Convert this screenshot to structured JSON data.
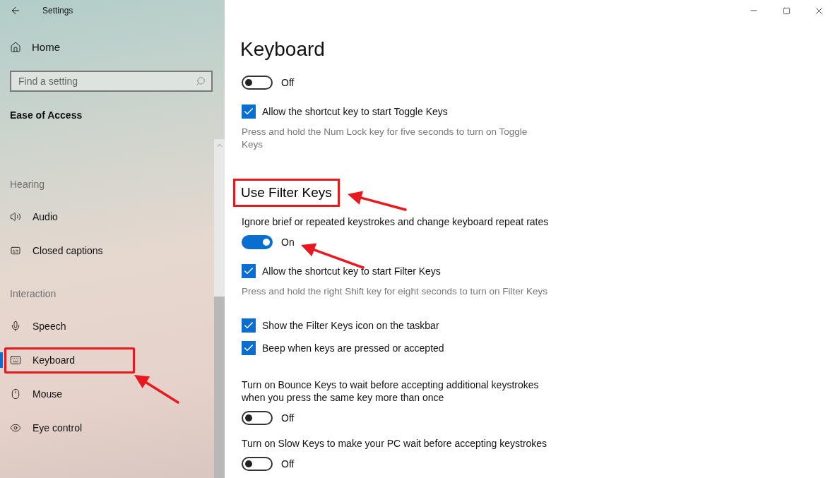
{
  "window": {
    "title": "Settings"
  },
  "sidebar": {
    "home": "Home",
    "search": {
      "placeholder": "Find a setting"
    },
    "section": "Ease of Access",
    "groups": [
      {
        "label": "Hearing",
        "items": [
          {
            "label": "Audio",
            "selected": false,
            "highlighted": false
          },
          {
            "label": "Closed captions",
            "selected": false,
            "highlighted": false
          }
        ]
      },
      {
        "label": "Interaction",
        "items": [
          {
            "label": "Speech",
            "selected": false,
            "highlighted": false
          },
          {
            "label": "Keyboard",
            "selected": true,
            "highlighted": true
          },
          {
            "label": "Mouse",
            "selected": false,
            "highlighted": false
          },
          {
            "label": "Eye control",
            "selected": false,
            "highlighted": false
          }
        ]
      }
    ]
  },
  "page": {
    "title": "Keyboard",
    "settings": [
      {
        "kind": "toggle",
        "on": false,
        "label": "Off",
        "arrow": false
      },
      {
        "kind": "checkbox",
        "checked": true,
        "label": "Allow the shortcut key to start Toggle Keys"
      },
      {
        "kind": "description",
        "text": "Press and hold the Num Lock key for five seconds to turn on Toggle Keys"
      },
      {
        "kind": "heading",
        "text": "Use Filter Keys",
        "highlighted": true
      },
      {
        "kind": "text",
        "text": "Ignore brief or repeated keystrokes and change keyboard repeat rates"
      },
      {
        "kind": "toggle",
        "on": true,
        "label": "On",
        "arrow": true
      },
      {
        "kind": "checkbox",
        "checked": true,
        "label": "Allow the shortcut key to start Filter Keys"
      },
      {
        "kind": "description",
        "text": "Press and hold the right Shift key for eight seconds to turn on Filter Keys"
      },
      {
        "kind": "checkbox",
        "checked": true,
        "label": "Show the Filter Keys icon on the taskbar"
      },
      {
        "kind": "checkbox",
        "checked": true,
        "label": "Beep when keys are pressed or accepted"
      },
      {
        "kind": "text",
        "text": "Turn on Bounce Keys to wait before accepting additional keystrokes when you press the same key more than once"
      },
      {
        "kind": "toggle",
        "on": false,
        "label": "Off",
        "arrow": false
      },
      {
        "kind": "text",
        "text": "Turn on Slow Keys to make your PC wait before accepting keystrokes"
      },
      {
        "kind": "toggle",
        "on": false,
        "label": "Off",
        "arrow": false
      }
    ]
  }
}
